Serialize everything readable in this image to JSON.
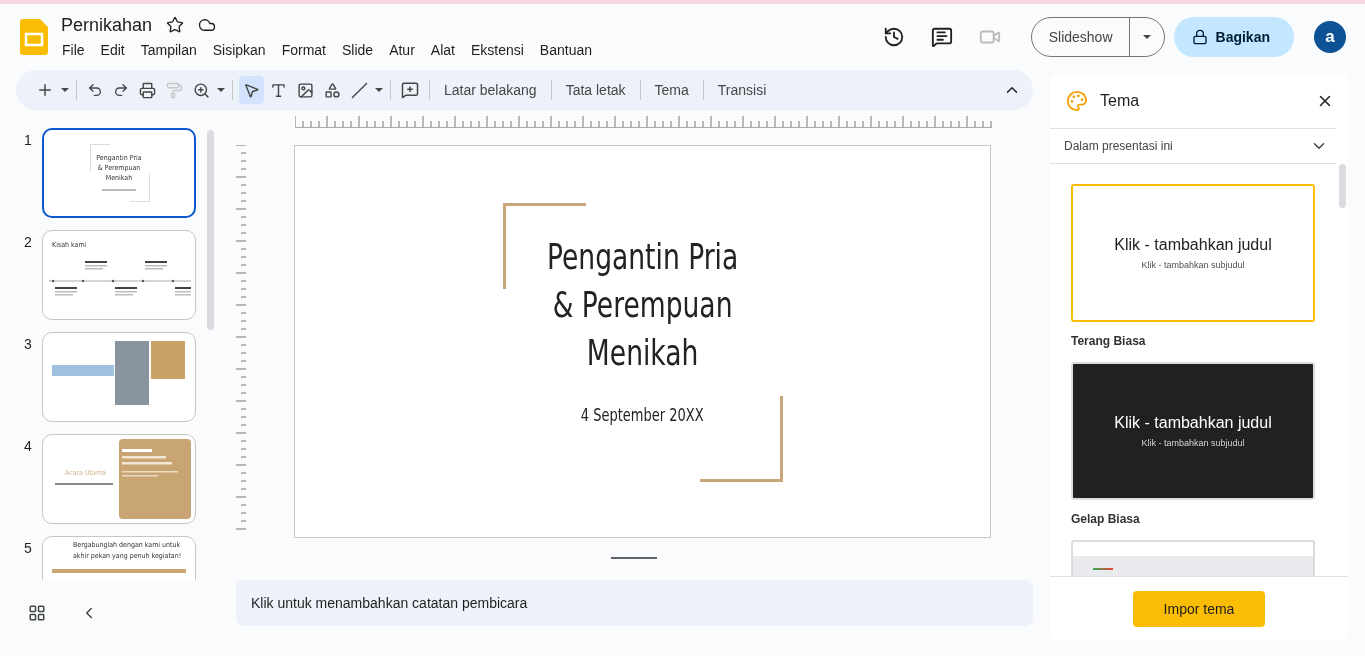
{
  "document": {
    "title": "Pernikahan"
  },
  "menu": [
    "File",
    "Edit",
    "Tampilan",
    "Sisipkan",
    "Format",
    "Slide",
    "Atur",
    "Alat",
    "Ekstensi",
    "Bantuan"
  ],
  "header": {
    "slideshow": "Slideshow",
    "share": "Bagikan",
    "avatar": "a"
  },
  "toolbar": {
    "buttons": [
      "Latar belakang",
      "Tata letak",
      "Tema",
      "Transisi"
    ]
  },
  "slides": [
    {
      "number": "1",
      "selected": true,
      "kind": "title",
      "title_lines": [
        "Pengantin Pria",
        "& Perempuan",
        "Menikah"
      ]
    },
    {
      "number": "2",
      "selected": false,
      "kind": "timeline",
      "heading": "Kisah kami"
    },
    {
      "number": "3",
      "selected": false,
      "kind": "photos"
    },
    {
      "number": "4",
      "selected": false,
      "kind": "event",
      "heading": "Acara Utama"
    },
    {
      "number": "5",
      "selected": false,
      "kind": "join",
      "heading_lines": [
        "Bergabunglah dengan kami untuk",
        "akhir pekan yang penuh kegiatan!"
      ]
    }
  ],
  "slide": {
    "title_lines": [
      "Pengantin Pria",
      "& Perempuan",
      "Menikah"
    ],
    "date": "4 September 20XX"
  },
  "notes": {
    "placeholder": "Klik untuk menambahkan catatan pembicara"
  },
  "theme_panel": {
    "title": "Tema",
    "filter": "Dalam presentasi ini",
    "import_button": "Impor tema",
    "themes": [
      {
        "kind": "light",
        "selected": true,
        "name": "Terang Biasa",
        "heading": "Klik - tambahkan judul",
        "subheading": "Klik - tambahkan subjudul"
      },
      {
        "kind": "dark",
        "selected": false,
        "name": "Gelap Biasa",
        "heading": "Klik - tambahkan judul",
        "subheading": "Klik - tambahkan subjudul"
      },
      {
        "kind": "accent",
        "selected": false
      }
    ]
  }
}
